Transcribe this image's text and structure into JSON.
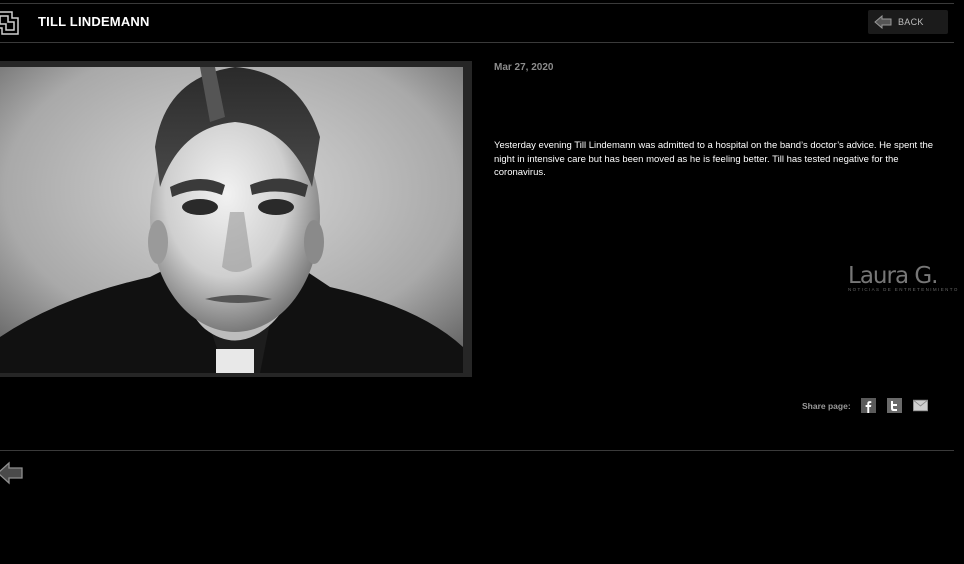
{
  "header": {
    "title": "TILL LINDEMANN",
    "back_label": "BACK"
  },
  "article": {
    "date": "Mar 27, 2020",
    "body": "Yesterday evening Till Lindemann was admitted to a hospital on the band’s doctor’s advice. He spent the night in intensive care but has been moved as he is feeling better. Till has tested negative for the coronavirus."
  },
  "watermark": {
    "name": "Laura G.",
    "tagline": "NOTICIAS DE ENTRETENIMIENTO"
  },
  "share": {
    "label": "Share page:",
    "buttons": [
      {
        "icon": "facebook-icon"
      },
      {
        "icon": "twitter-icon"
      },
      {
        "icon": "mail-icon"
      }
    ]
  },
  "colors": {
    "background": "#000000",
    "rule": "#3a3a3a",
    "date": "#8c8c8c",
    "button_bg": "#1b1b1b"
  }
}
